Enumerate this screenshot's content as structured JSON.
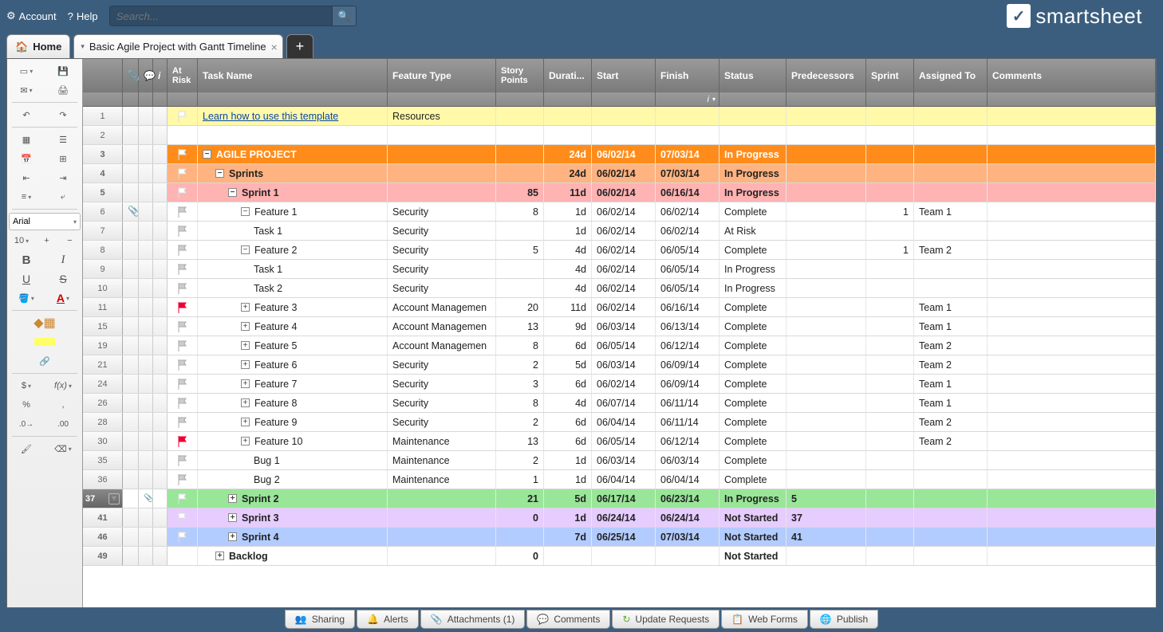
{
  "topbar": {
    "account": "Account",
    "help": "Help",
    "search_placeholder": "Search..."
  },
  "brand": "smartsheet",
  "tabs": {
    "home": "Home",
    "sheet": "Basic Agile Project with Gantt Timeline"
  },
  "toolbar": {
    "font": "Arial",
    "size": "10"
  },
  "columns": {
    "risk": "At Risk",
    "task": "Task Name",
    "ftype": "Feature Type",
    "story": "Story Points",
    "dur": "Durati...",
    "start": "Start",
    "finish": "Finish",
    "status": "Status",
    "pred": "Predecessors",
    "sprint": "Sprint",
    "assign": "Assigned To",
    "comm": "Comments"
  },
  "rows": [
    {
      "n": "1",
      "bg": "bg-yellow",
      "flag": "white",
      "task": "Learn how to use this template",
      "link": true,
      "ftype": "Resources"
    },
    {
      "n": "2"
    },
    {
      "n": "3",
      "bg": "bg-orange",
      "bold": true,
      "flag": "white",
      "exp": "-",
      "indent": 0,
      "task": "AGILE PROJECT",
      "dur": "24d",
      "start": "06/02/14",
      "finish": "07/03/14",
      "status": "In Progress"
    },
    {
      "n": "4",
      "bg": "bg-orange2",
      "bold": true,
      "flag": "white",
      "exp": "-",
      "indent": 1,
      "task": "Sprints",
      "dur": "24d",
      "start": "06/02/14",
      "finish": "07/03/14",
      "status": "In Progress"
    },
    {
      "n": "5",
      "bg": "bg-pink",
      "bold": true,
      "flag": "white",
      "exp": "-",
      "indent": 2,
      "task": "Sprint 1",
      "story": "85",
      "dur": "11d",
      "start": "06/02/14",
      "finish": "06/16/14",
      "status": "In Progress"
    },
    {
      "n": "6",
      "attach": true,
      "flag": "gray",
      "exp": "-",
      "indent": 3,
      "task": "Feature 1",
      "ftype": "Security",
      "story": "8",
      "dur": "1d",
      "start": "06/02/14",
      "finish": "06/02/14",
      "status": "Complete",
      "sprint": "1",
      "assign": "Team 1"
    },
    {
      "n": "7",
      "flag": "gray",
      "indent": 4,
      "task": "Task 1",
      "ftype": "Security",
      "dur": "1d",
      "start": "06/02/14",
      "finish": "06/02/14",
      "status": "At Risk"
    },
    {
      "n": "8",
      "flag": "gray",
      "exp": "-",
      "indent": 3,
      "task": "Feature 2",
      "ftype": "Security",
      "story": "5",
      "dur": "4d",
      "start": "06/02/14",
      "finish": "06/05/14",
      "status": "Complete",
      "sprint": "1",
      "assign": "Team 2"
    },
    {
      "n": "9",
      "flag": "gray",
      "indent": 4,
      "task": "Task 1",
      "ftype": "Security",
      "dur": "4d",
      "start": "06/02/14",
      "finish": "06/05/14",
      "status": "In Progress"
    },
    {
      "n": "10",
      "flag": "gray",
      "indent": 4,
      "task": "Task 2",
      "ftype": "Security",
      "dur": "4d",
      "start": "06/02/14",
      "finish": "06/05/14",
      "status": "In Progress"
    },
    {
      "n": "11",
      "flag": "red",
      "exp": "+",
      "indent": 3,
      "task": "Feature 3",
      "ftype": "Account Managemen",
      "story": "20",
      "dur": "11d",
      "start": "06/02/14",
      "finish": "06/16/14",
      "status": "Complete",
      "assign": "Team 1"
    },
    {
      "n": "15",
      "flag": "gray",
      "exp": "+",
      "indent": 3,
      "task": "Feature 4",
      "ftype": "Account Managemen",
      "story": "13",
      "dur": "9d",
      "start": "06/03/14",
      "finish": "06/13/14",
      "status": "Complete",
      "assign": "Team 1"
    },
    {
      "n": "19",
      "flag": "gray",
      "exp": "+",
      "indent": 3,
      "task": "Feature 5",
      "ftype": "Account Managemen",
      "story": "8",
      "dur": "6d",
      "start": "06/05/14",
      "finish": "06/12/14",
      "status": "Complete",
      "assign": "Team 2"
    },
    {
      "n": "21",
      "flag": "gray",
      "exp": "+",
      "indent": 3,
      "task": "Feature 6",
      "ftype": "Security",
      "story": "2",
      "dur": "5d",
      "start": "06/03/14",
      "finish": "06/09/14",
      "status": "Complete",
      "assign": "Team 2"
    },
    {
      "n": "24",
      "flag": "gray",
      "exp": "+",
      "indent": 3,
      "task": "Feature 7",
      "ftype": "Security",
      "story": "3",
      "dur": "6d",
      "start": "06/02/14",
      "finish": "06/09/14",
      "status": "Complete",
      "assign": "Team 1"
    },
    {
      "n": "26",
      "flag": "gray",
      "exp": "+",
      "indent": 3,
      "task": "Feature 8",
      "ftype": "Security",
      "story": "8",
      "dur": "4d",
      "start": "06/07/14",
      "finish": "06/11/14",
      "status": "Complete",
      "assign": "Team 1"
    },
    {
      "n": "28",
      "flag": "gray",
      "exp": "+",
      "indent": 3,
      "task": "Feature 9",
      "ftype": "Security",
      "story": "2",
      "dur": "6d",
      "start": "06/04/14",
      "finish": "06/11/14",
      "status": "Complete",
      "assign": "Team 2"
    },
    {
      "n": "30",
      "flag": "red",
      "exp": "+",
      "indent": 3,
      "task": "Feature 10",
      "ftype": "Maintenance",
      "story": "13",
      "dur": "6d",
      "start": "06/05/14",
      "finish": "06/12/14",
      "status": "Complete",
      "assign": "Team 2"
    },
    {
      "n": "35",
      "flag": "gray",
      "indent": 4,
      "task": "Bug 1",
      "ftype": "Maintenance",
      "story": "2",
      "dur": "1d",
      "start": "06/03/14",
      "finish": "06/03/14",
      "status": "Complete"
    },
    {
      "n": "36",
      "flag": "gray",
      "indent": 4,
      "task": "Bug 2",
      "ftype": "Maintenance",
      "story": "1",
      "dur": "1d",
      "start": "06/04/14",
      "finish": "06/04/14",
      "status": "Complete"
    },
    {
      "n": "37",
      "bg": "bg-green",
      "bold": true,
      "sel": true,
      "flag": "white",
      "exp": "+",
      "indent": 2,
      "task": "Sprint 2",
      "story": "21",
      "dur": "5d",
      "start": "06/17/14",
      "finish": "06/23/14",
      "status": "In Progress",
      "pred": "5"
    },
    {
      "n": "41",
      "bg": "bg-purple",
      "bold": true,
      "flag": "white",
      "exp": "+",
      "indent": 2,
      "task": "Sprint 3",
      "story": "0",
      "dur": "1d",
      "start": "06/24/14",
      "finish": "06/24/14",
      "status": "Not Started",
      "pred": "37"
    },
    {
      "n": "46",
      "bg": "bg-blue",
      "bold": true,
      "flag": "white",
      "exp": "+",
      "indent": 2,
      "task": "Sprint 4",
      "dur": "7d",
      "start": "06/25/14",
      "finish": "07/03/14",
      "status": "Not Started",
      "pred": "41"
    },
    {
      "n": "49",
      "bold": true,
      "exp": "+",
      "indent": 1,
      "task": "Backlog",
      "story": "0",
      "status": "Not Started"
    }
  ],
  "bottom": {
    "sharing": "Sharing",
    "alerts": "Alerts",
    "attachments": "Attachments (1)",
    "comments": "Comments",
    "updates": "Update Requests",
    "webforms": "Web Forms",
    "publish": "Publish"
  }
}
